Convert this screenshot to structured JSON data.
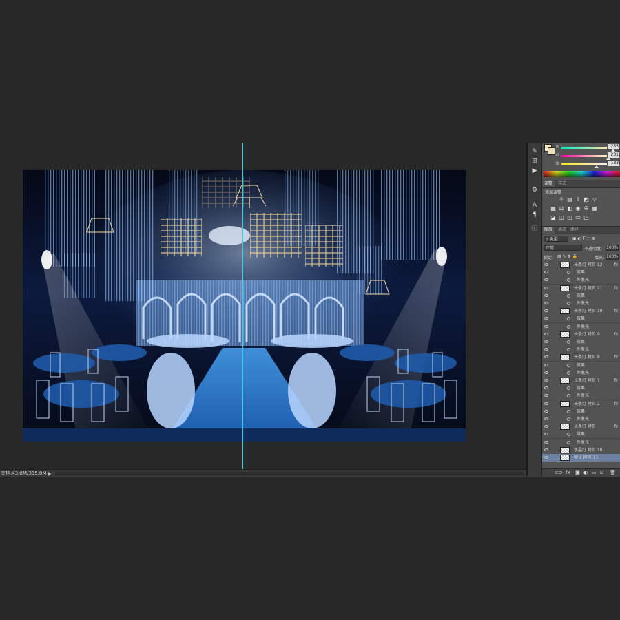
{
  "status": {
    "doc_size": "文档:43.8M/395.8M"
  },
  "toolstrip": {
    "icons": [
      "color-icon",
      "adjust-icon",
      "play-icon",
      "tools-icon",
      "character-icon",
      "paragraph-icon",
      "info-icon"
    ]
  },
  "color": {
    "fg": "#fff0c8",
    "bg": "#f0e0b7",
    "r_label": "R",
    "r_value": "255",
    "g_label": "G",
    "g_value": "231",
    "b_label": "B",
    "b_value": "183"
  },
  "adjustments": {
    "tabs": [
      "调整",
      "样式"
    ],
    "title": "添加调整"
  },
  "layers": {
    "tabs": [
      "图层",
      "通道",
      "路径"
    ],
    "filter_kind": "ρ 类型",
    "blend_mode": "正常",
    "opacity_label": "不透明度:",
    "opacity_value": "100%",
    "lock_label": "锁定:",
    "fill_label": "填充:",
    "fill_value": "100%",
    "rows": [
      {
        "type": "main",
        "name": "长条灯 拷贝 12",
        "fx": "fx"
      },
      {
        "type": "sub",
        "name": "效果"
      },
      {
        "type": "sub",
        "name": "外发光"
      },
      {
        "type": "main",
        "name": "长条灯 拷贝 11",
        "fx": "fx"
      },
      {
        "type": "sub",
        "name": "效果"
      },
      {
        "type": "sub",
        "name": "外发光"
      },
      {
        "type": "main",
        "name": "长条灯 拷贝 10",
        "fx": "fx"
      },
      {
        "type": "sub",
        "name": "效果"
      },
      {
        "type": "sub",
        "name": "外发光"
      },
      {
        "type": "main",
        "name": "长条灯 拷贝 9",
        "fx": "fx"
      },
      {
        "type": "sub",
        "name": "效果"
      },
      {
        "type": "sub",
        "name": "外发光"
      },
      {
        "type": "main",
        "name": "长条灯 拷贝 8",
        "fx": "fx"
      },
      {
        "type": "sub",
        "name": "效果"
      },
      {
        "type": "sub",
        "name": "外发光"
      },
      {
        "type": "main",
        "name": "长条灯 拷贝 7",
        "fx": "fx"
      },
      {
        "type": "sub",
        "name": "效果"
      },
      {
        "type": "sub",
        "name": "外发光"
      },
      {
        "type": "main",
        "name": "长条灯 拷贝 2",
        "fx": "fx"
      },
      {
        "type": "sub",
        "name": "效果"
      },
      {
        "type": "sub",
        "name": "外发光"
      },
      {
        "type": "main",
        "name": "长条灯 拷贝",
        "fx": "fx"
      },
      {
        "type": "sub",
        "name": "效果"
      },
      {
        "type": "sub",
        "name": "外发光"
      },
      {
        "type": "main",
        "name": "水晶灯 拷贝 10",
        "fx": ""
      },
      {
        "type": "selected",
        "name": "组 1 拷贝 13",
        "fx": ""
      }
    ]
  }
}
